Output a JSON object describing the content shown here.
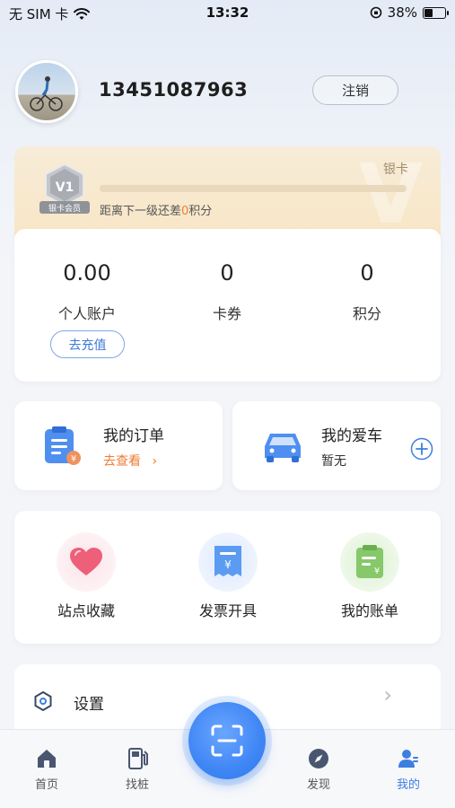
{
  "status_bar": {
    "carrier": "无 SIM 卡",
    "time": "13:32",
    "battery": "38%",
    "battery_level": 0.38
  },
  "profile": {
    "phone": "13451087963",
    "logout_label": "注销"
  },
  "member": {
    "badge_level": "V1",
    "badge_label": "银卡会员",
    "level_name": "银卡",
    "progress": 0,
    "tip_prefix": "距离下一级还差",
    "tip_points": "0",
    "tip_suffix": "积分"
  },
  "account": {
    "stats": [
      {
        "value": "0.00",
        "label": "个人账户"
      },
      {
        "value": "0",
        "label": "卡券"
      },
      {
        "value": "0",
        "label": "积分"
      }
    ],
    "recharge_label": "去充值"
  },
  "orders": {
    "title": "我的订单",
    "link": "去查看"
  },
  "car": {
    "title": "我的爱车",
    "status": "暂无"
  },
  "tools": [
    {
      "label": "站点收藏",
      "icon": "heart-icon"
    },
    {
      "label": "发票开具",
      "icon": "invoice-icon"
    },
    {
      "label": "我的账单",
      "icon": "bill-icon"
    }
  ],
  "settings": {
    "label": "设置",
    "icon": "settings-icon"
  },
  "tabs": [
    {
      "label": "首页",
      "icon": "home-icon",
      "active": false
    },
    {
      "label": "找桩",
      "icon": "charging-station-icon",
      "active": false
    },
    {
      "label": "发现",
      "icon": "compass-icon",
      "active": false
    },
    {
      "label": "我的",
      "icon": "user-icon",
      "active": true
    }
  ],
  "colors": {
    "accent": "#3d7fe0",
    "orange": "#ef7c34",
    "gold_bg": "#f8e6c6",
    "heart": "#ee5f7a",
    "invoice": "#5b9bf2",
    "bill": "#86c86a"
  }
}
